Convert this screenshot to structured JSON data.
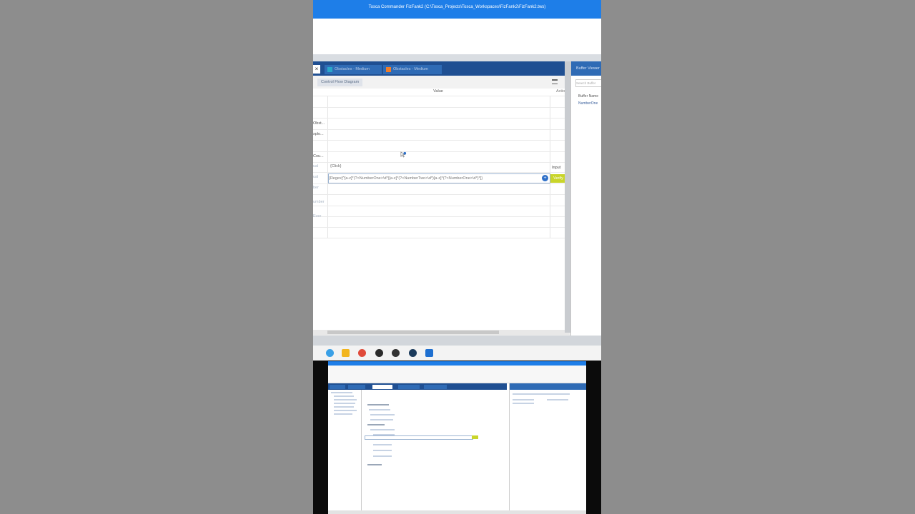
{
  "window": {
    "title": "Tosca Commander FizFank2 (C:\\Tosca_Projects\\Tosca_Workspaces\\FizFank2\\FizFank2.tws)"
  },
  "tabs": [
    {
      "label": "Obstacles - Medium",
      "color": "#2aa7c9"
    },
    {
      "label": "Obstacles - Medium",
      "color": "#f07d2a"
    }
  ],
  "subtabs": {
    "control_flow": "Control Flow Diagram"
  },
  "grid": {
    "value_header": "Value",
    "action_header": "Actio",
    "row_labels": [
      "Obst...",
      "xplo...",
      "Cou...",
      "ual",
      "ual",
      "ber",
      "umber",
      "Ever"
    ],
    "click_value": "{Click}",
    "action_input": "Input",
    "regex_value": "{Regex[^[a-z]*(?<NumberOne>\\d*)[a-z]*(?<NumberTwo>\\d*)[a-z]*(?<NumberOne>\\d*)*]}",
    "verify_label": "Verify"
  },
  "buffer": {
    "title": "Buffer Viewer",
    "search_placeholder": "Search Buffer",
    "column_header": "Buffer Name",
    "row": "NumberOne"
  },
  "taskbar": {
    "icons": [
      "edge-icon",
      "folder-icon",
      "chrome-icon",
      "obs-icon",
      "app-icon",
      "steam-icon",
      "tosca-icon"
    ]
  }
}
